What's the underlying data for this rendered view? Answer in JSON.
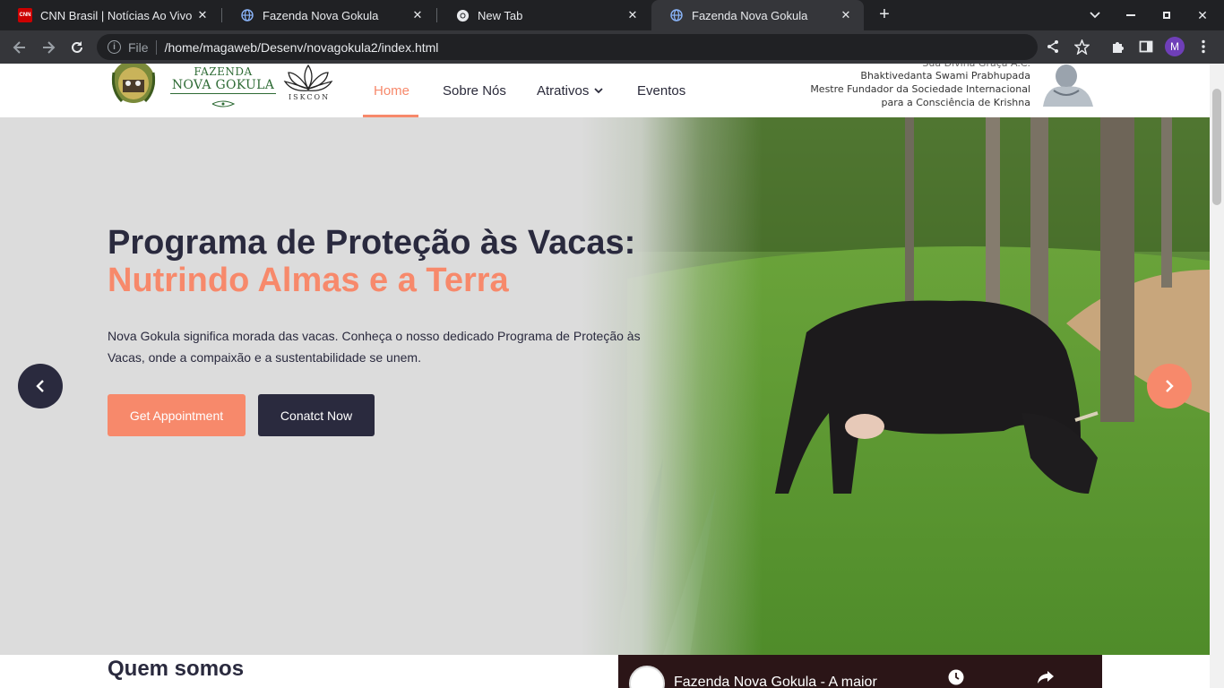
{
  "browser": {
    "tabs": [
      {
        "title": "CNN Brasil | Notícias Ao Vivo",
        "icon": "cnn-favicon",
        "active": false
      },
      {
        "title": "Fazenda Nova Gokula",
        "icon": "globe-icon",
        "active": false
      },
      {
        "title": "New Tab",
        "icon": "chrome-icon",
        "active": false
      },
      {
        "title": "Fazenda Nova Gokula",
        "icon": "globe-icon",
        "active": true
      }
    ],
    "cnn_badge": "CNN",
    "omnibox": {
      "scheme_label": "File",
      "url": "/home/magaweb/Desenv/novagokula2/index.html"
    },
    "profile_initial": "M"
  },
  "site": {
    "logo": {
      "line1": "FAZENDA",
      "line2": "NOVA GOKULA",
      "iskcon": "ISKCON"
    },
    "nav": {
      "home": "Home",
      "about": "Sobre Nós",
      "attractions": "Atrativos",
      "events": "Eventos"
    },
    "founder": {
      "line1": "Sua Divina Graça A.C.",
      "line2": "Bhaktivedanta Swami Prabhupada",
      "line3": "Mestre Fundador da Sociedade Internacional",
      "line4": "para a Consciência de Krishna"
    },
    "hero": {
      "title_dark": "Programa de Proteção às Vacas:",
      "title_accent": "Nutrindo Almas e a Terra",
      "description": "Nova Gokula significa morada das vacas. Conheça o nosso dedicado Programa de Proteção às Vacas, onde a compaixão e a sustentabilidade se unem.",
      "btn_primary": "Get Appointment",
      "btn_secondary": "Conatct Now"
    },
    "about": {
      "title": "Quem somos"
    },
    "video": {
      "title": "Fazenda Nova Gokula - A maior"
    }
  },
  "colors": {
    "accent": "#f7896b",
    "dark": "#2a2a3e",
    "green": "#2e6b35"
  }
}
